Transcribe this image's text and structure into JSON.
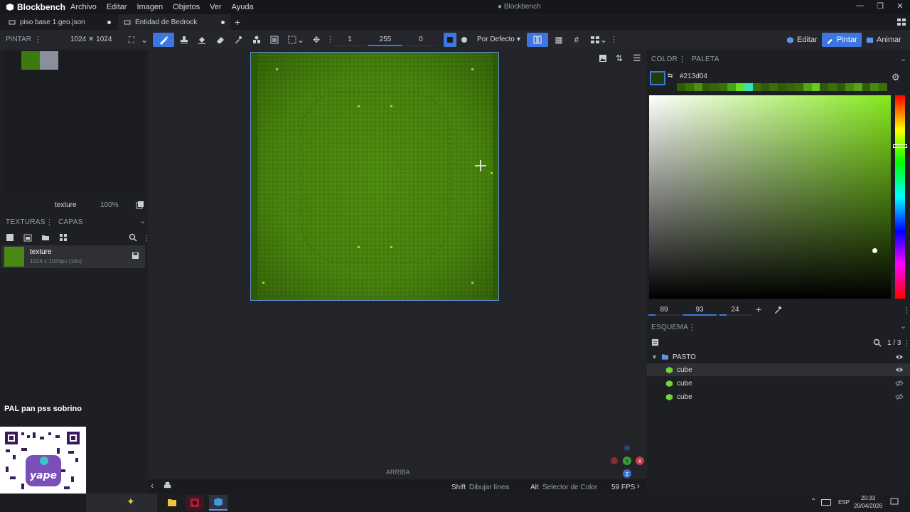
{
  "titlebar": {
    "app_name": "Blockbench",
    "menu": [
      "Archivo",
      "Editar",
      "Imagen",
      "Objetos",
      "Ver",
      "Ayuda"
    ],
    "window_title": "● Blockbench",
    "minimize": "—",
    "maximize": "❐",
    "close": "✕"
  },
  "tabs": [
    {
      "label": "piso base 1.geo.json"
    },
    {
      "label": "Entidad de Bedrock"
    }
  ],
  "toolbar": {
    "left_label": "PINTAR",
    "resolution": "1024 ✕ 1024",
    "brush_size": "1",
    "opacity": "255",
    "softness": "0",
    "blend_mode": "Por Defecto",
    "modes": {
      "edit": "Editar",
      "paint": "Pintar",
      "animate": "Animar"
    }
  },
  "left_panel": {
    "swatch_colors": [
      "#3d7a0e",
      "#8a8f9c"
    ],
    "texture_name": "texture",
    "zoom": "100%",
    "tabs": {
      "textures": "TEXTURAS",
      "layers": "CAPAS"
    },
    "texture_item": {
      "name": "texture",
      "info": "1024 x 1024px (16x)"
    },
    "promo_text": "PAL pan pss sobrino"
  },
  "viewport": {
    "direction_label": "ARRIBA"
  },
  "color_panel": {
    "tabs": {
      "color": "COLOR",
      "palette": "PALETA"
    },
    "hex": "#213d04",
    "current_color": "#213d04",
    "hsv": {
      "h": "89",
      "s": "93",
      "v": "24"
    }
  },
  "outliner": {
    "title": "ESQUEMA",
    "count": "1 / 3",
    "group": "PASTO",
    "items": [
      {
        "label": "cube",
        "visible": true,
        "selected": true
      },
      {
        "label": "cube",
        "visible": false,
        "selected": false
      },
      {
        "label": "cube",
        "visible": false,
        "selected": false
      }
    ]
  },
  "statusbar": {
    "shift_key": "Shift",
    "shift_action": "Dibujar línea",
    "alt_key": "Alt",
    "alt_action": "Selector de Color",
    "fps": "59 FPS"
  },
  "taskbar": {
    "language": "ESP",
    "time": "20:33",
    "date": "20/04/2026"
  }
}
